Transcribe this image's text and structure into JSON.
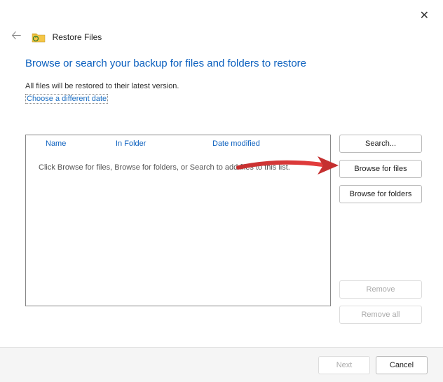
{
  "window": {
    "title": "Restore Files"
  },
  "page": {
    "heading": "Browse or search your backup for files and folders to restore",
    "subtext": "All files will be restored to their latest version.",
    "date_link": "Choose a different date"
  },
  "list": {
    "columns": {
      "name": "Name",
      "folder": "In Folder",
      "date": "Date modified"
    },
    "hint": "Click Browse for files, Browse for folders, or Search to add files to this list."
  },
  "buttons": {
    "search": "Search...",
    "browse_files": "Browse for files",
    "browse_folders": "Browse for folders",
    "remove": "Remove",
    "remove_all": "Remove all",
    "next": "Next",
    "cancel": "Cancel"
  }
}
